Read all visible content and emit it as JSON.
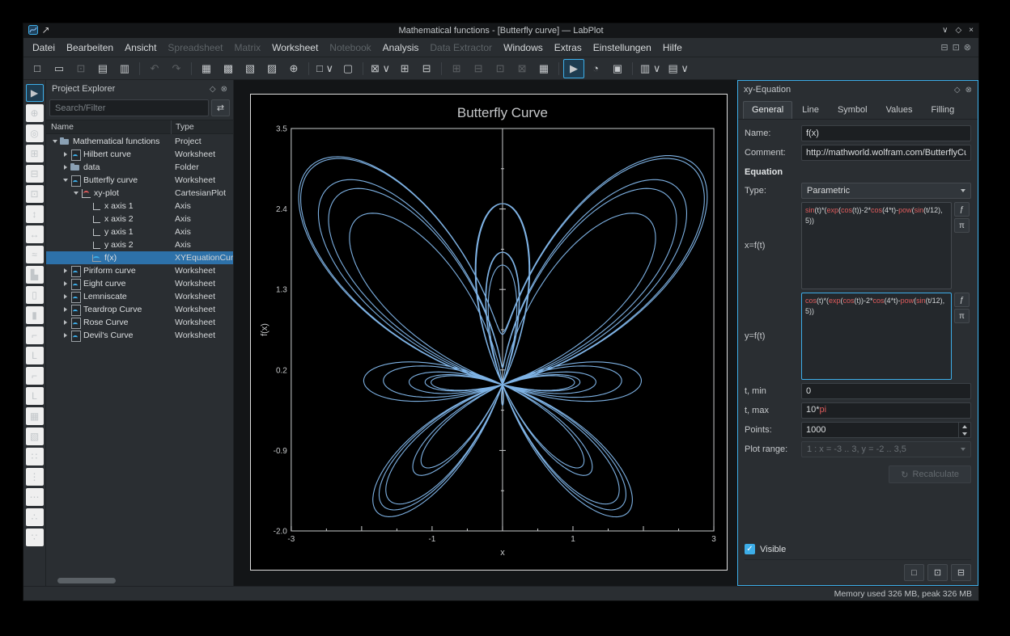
{
  "window": {
    "title": "Mathematical functions - [Butterfly curve] — LabPlot"
  },
  "icons": {
    "chevron_down": "∨",
    "diamond": "◇",
    "close": "×",
    "float_dock": "◇",
    "close_dock": "⊗",
    "mdi_minimize": "⊟",
    "mdi_restore": "⊡",
    "mdi_close": "⊗",
    "search_config": "⇄",
    "function_btn": "ƒ",
    "constant_btn": "π",
    "recalculate": "↻",
    "check": "✓",
    "template_new": "□",
    "template_save": "⊡",
    "template_export": "⊟"
  },
  "menu": {
    "items": [
      {
        "label": "Datei",
        "dataName": "menu-datei"
      },
      {
        "label": "Bearbeiten",
        "dataName": "menu-bearbeiten"
      },
      {
        "label": "Ansicht",
        "dataName": "menu-ansicht"
      },
      {
        "label": "Spreadsheet",
        "dataName": "menu-spreadsheet",
        "class": "disabled"
      },
      {
        "label": "Matrix",
        "dataName": "menu-matrix",
        "class": "disabled"
      },
      {
        "label": "Worksheet",
        "dataName": "menu-worksheet"
      },
      {
        "label": "Notebook",
        "dataName": "menu-notebook",
        "class": "disabled"
      },
      {
        "label": "Analysis",
        "dataName": "menu-analysis"
      },
      {
        "label": "Data Extractor",
        "dataName": "menu-data-extractor",
        "class": "disabled"
      },
      {
        "label": "Windows",
        "dataName": "menu-windows"
      },
      {
        "label": "Extras",
        "dataName": "menu-extras"
      },
      {
        "label": "Einstellungen",
        "dataName": "menu-einstellungen"
      },
      {
        "label": "Hilfe",
        "dataName": "menu-hilfe"
      }
    ]
  },
  "toolbar": {
    "items": [
      {
        "glyph": "□",
        "dataName": "toolbar-new-project-button"
      },
      {
        "glyph": "▭",
        "dataName": "toolbar-open-project-button"
      },
      {
        "glyph": "⊡",
        "dataName": "toolbar-save-project-button",
        "class": "disabled"
      },
      {
        "glyph": "▤",
        "dataName": "toolbar-print-button"
      },
      {
        "glyph": "▥",
        "dataName": "toolbar-print-preview-button"
      },
      {
        "glyph": "",
        "dataName": "toolbar-separator",
        "class": "sep",
        "inter": "false"
      },
      {
        "glyph": "↶",
        "dataName": "toolbar-undo-button",
        "class": "disabled"
      },
      {
        "glyph": "↷",
        "dataName": "toolbar-redo-button",
        "class": "disabled"
      },
      {
        "glyph": "",
        "dataName": "toolbar-separator",
        "class": "sep",
        "inter": "false"
      },
      {
        "glyph": "▦",
        "dataName": "toolbar-new-spreadsheet-button"
      },
      {
        "glyph": "▩",
        "dataName": "toolbar-new-matrix-button"
      },
      {
        "glyph": "▧",
        "dataName": "toolbar-new-worksheet-button"
      },
      {
        "glyph": "▨",
        "dataName": "toolbar-new-notebook-button"
      },
      {
        "glyph": "⊕",
        "dataName": "toolbar-new-datapicker-button"
      },
      {
        "glyph": "",
        "dataName": "toolbar-separator",
        "class": "sep",
        "inter": "false"
      },
      {
        "glyph": "□ ∨",
        "dataName": "toolbar-new-object-dropdown"
      },
      {
        "glyph": "▢",
        "dataName": "toolbar-new-folder-button"
      },
      {
        "glyph": "",
        "dataName": "toolbar-separator",
        "class": "sep",
        "inter": "false"
      },
      {
        "glyph": "⊠ ∨",
        "dataName": "toolbar-zoom-dropdown"
      },
      {
        "glyph": "⊞",
        "dataName": "toolbar-zoom-fit-button"
      },
      {
        "glyph": "⊟",
        "dataName": "toolbar-zoom-original-button"
      },
      {
        "glyph": "",
        "dataName": "toolbar-separator",
        "class": "sep",
        "inter": "false"
      },
      {
        "glyph": "⊞",
        "dataName": "toolbar-split-horizontal-button",
        "class": "disabled"
      },
      {
        "glyph": "⊟",
        "dataName": "toolbar-split-vertical-button",
        "class": "disabled"
      },
      {
        "glyph": "⊡",
        "dataName": "toolbar-close-split-button",
        "class": "disabled"
      },
      {
        "glyph": "⊠",
        "dataName": "toolbar-close-window-button",
        "class": "disabled"
      },
      {
        "glyph": "▦",
        "dataName": "toolbar-add-plot-button"
      },
      {
        "glyph": "",
        "dataName": "toolbar-separator",
        "class": "sep",
        "inter": "false"
      },
      {
        "glyph": "▶",
        "dataName": "toolbar-navigate-mode-button",
        "class": "active"
      },
      {
        "glyph": "◔",
        "dataName": "toolbar-presenter-mode-button"
      },
      {
        "glyph": "▣",
        "dataName": "toolbar-fullscreen-button"
      },
      {
        "glyph": "",
        "dataName": "toolbar-separator",
        "class": "sep",
        "inter": "false"
      },
      {
        "glyph": "▥ ∨",
        "dataName": "toolbar-layout-dropdown"
      },
      {
        "glyph": "▤ ∨",
        "dataName": "toolbar-arrange-dropdown"
      }
    ]
  },
  "left_toolbar": {
    "items": [
      {
        "glyph": "▶",
        "dataName": "tool-select-button",
        "class": "active"
      },
      {
        "glyph": "⊕",
        "dataName": "tool-crosshair-button"
      },
      {
        "glyph": "◎",
        "dataName": "tool-zoom-select-button"
      },
      {
        "glyph": "⊞",
        "dataName": "tool-zoom-box-button"
      },
      {
        "glyph": "⊟",
        "dataName": "tool-zoom-x-button"
      },
      {
        "glyph": "⊡",
        "dataName": "tool-zoom-y-button"
      },
      {
        "glyph": "↕",
        "dataName": "tool-shift-vertical-button"
      },
      {
        "glyph": "↔",
        "dataName": "tool-shift-horizontal-button"
      },
      {
        "glyph": "≈",
        "dataName": "tool-add-curve-button"
      },
      {
        "glyph": "▙",
        "dataName": "tool-add-histogram-button"
      },
      {
        "glyph": "▯",
        "dataName": "tool-add-boxplot-button"
      },
      {
        "glyph": "▮",
        "dataName": "tool-add-barplot-button"
      },
      {
        "glyph": "⌐",
        "dataName": "tool-add-axis-top-button"
      },
      {
        "glyph": "L",
        "dataName": "tool-add-axis-left-button"
      },
      {
        "glyph": "⌐",
        "dataName": "tool-add-axis-right-button"
      },
      {
        "glyph": "L",
        "dataName": "tool-add-axis-bottom-button"
      },
      {
        "glyph": "▦",
        "dataName": "tool-add-cartesian-plot-button"
      },
      {
        "glyph": "▧",
        "dataName": "tool-add-plot-template-button"
      },
      {
        "glyph": "∷",
        "dataName": "tool-align-grid-button"
      },
      {
        "glyph": "⋮",
        "dataName": "tool-align-vertical-button"
      },
      {
        "glyph": "⋯",
        "dataName": "tool-align-horizontal-button"
      },
      {
        "glyph": "∴",
        "dataName": "tool-distribute-button"
      },
      {
        "glyph": "∵",
        "dataName": "tool-snap-button"
      }
    ]
  },
  "project_explorer": {
    "title": "Project Explorer",
    "search_placeholder": "Search/Filter",
    "columns": {
      "name": "Name",
      "type": "Type"
    },
    "rows": [
      {
        "name": "Mathematical functions",
        "type": "Project",
        "level": 0,
        "expClass": "exp open",
        "iconClass": "row-icon icon-project",
        "dataName": "tree-row-mathematical-functions"
      },
      {
        "name": "Hilbert curve",
        "type": "Worksheet",
        "level": 1,
        "expClass": "exp closed",
        "iconClass": "row-icon icon-worksheet",
        "dataName": "tree-row-hilbert-curve"
      },
      {
        "name": "data",
        "type": "Folder",
        "level": 1,
        "expClass": "exp closed",
        "iconClass": "row-icon icon-folder",
        "dataName": "tree-row-data"
      },
      {
        "name": "Butterfly curve",
        "type": "Worksheet",
        "level": 1,
        "expClass": "exp open",
        "iconClass": "row-icon icon-worksheet",
        "dataName": "tree-row-butterfly-curve"
      },
      {
        "name": "xy-plot",
        "type": "CartesianPlot",
        "level": 2,
        "expClass": "exp open",
        "iconClass": "row-icon icon-plot",
        "dataName": "tree-row-xy-plot"
      },
      {
        "name": "x axis 1",
        "type": "Axis",
        "level": 3,
        "expClass": "exp none",
        "expInter": "false",
        "iconClass": "row-icon icon-axis",
        "dataName": "tree-row-x-axis-1"
      },
      {
        "name": "x axis 2",
        "type": "Axis",
        "level": 3,
        "expClass": "exp none",
        "expInter": "false",
        "iconClass": "row-icon icon-axis",
        "dataName": "tree-row-x-axis-2"
      },
      {
        "name": "y axis 1",
        "type": "Axis",
        "level": 3,
        "expClass": "exp none",
        "expInter": "false",
        "iconClass": "row-icon icon-axis",
        "dataName": "tree-row-y-axis-1"
      },
      {
        "name": "y axis 2",
        "type": "Axis",
        "level": 3,
        "expClass": "exp none",
        "expInter": "false",
        "iconClass": "row-icon icon-axis",
        "dataName": "tree-row-y-axis-2"
      },
      {
        "name": "f(x)",
        "type": "XYEquationCurve",
        "level": 3,
        "class": "selected",
        "expClass": "exp none",
        "expInter": "false",
        "iconClass": "row-icon icon-curve",
        "dataName": "tree-row-fx"
      },
      {
        "name": "Piriform curve",
        "type": "Worksheet",
        "level": 1,
        "expClass": "exp closed",
        "iconClass": "row-icon icon-worksheet",
        "dataName": "tree-row-piriform-curve"
      },
      {
        "name": "Eight curve",
        "type": "Worksheet",
        "level": 1,
        "expClass": "exp closed",
        "iconClass": "row-icon icon-worksheet",
        "dataName": "tree-row-eight-curve"
      },
      {
        "name": "Lemniscate",
        "type": "Worksheet",
        "level": 1,
        "expClass": "exp closed",
        "iconClass": "row-icon icon-worksheet",
        "dataName": "tree-row-lemniscate"
      },
      {
        "name": "Teardrop Curve",
        "type": "Worksheet",
        "level": 1,
        "expClass": "exp closed",
        "iconClass": "row-icon icon-worksheet",
        "dataName": "tree-row-teardrop-curve"
      },
      {
        "name": "Rose Curve",
        "type": "Worksheet",
        "level": 1,
        "expClass": "exp closed",
        "iconClass": "row-icon icon-worksheet",
        "dataName": "tree-row-rose-curve"
      },
      {
        "name": "Devil's Curve",
        "type": "Worksheet",
        "level": 1,
        "expClass": "exp closed",
        "iconClass": "row-icon icon-worksheet",
        "dataName": "tree-row-devils-curve"
      }
    ]
  },
  "chart_data": {
    "type": "line",
    "title": "Butterfly Curve",
    "xlabel": "x",
    "ylabel": "f(x)",
    "parametric": {
      "x_t": "sin(t)*(exp(cos(t))-2*cos(4*t)-pow(sin(t/12), 5))",
      "y_t": "cos(t)*(exp(cos(t))-2*cos(4*t)-pow(sin(t/12),5))",
      "t_min": "0",
      "t_max": "10*pi",
      "points": 1000
    },
    "xlim": [
      -3,
      3
    ],
    "ylim": [
      -2,
      3.5
    ],
    "xticks": [
      -3,
      -2,
      -1,
      0,
      1,
      2,
      3
    ],
    "xtick_labeled": [
      -3,
      -1,
      1,
      3
    ],
    "xtick_labels": [
      "-3",
      "-1",
      "1",
      "3"
    ],
    "yticks": [
      3.5,
      2.4,
      1.3,
      0.2,
      -0.9,
      -2.0
    ],
    "ytick_labels": [
      "3.5",
      "2.4",
      "1.3",
      "0.2",
      "-0.9",
      "-2.0"
    ],
    "grid": false,
    "legend": false,
    "colors": {
      "curve": "#7eb2e4",
      "frame": "#c9cbcd",
      "text": "#c6c8ca",
      "background": "#000000"
    }
  },
  "equation_panel": {
    "title": "xy-Equation",
    "tabs": [
      {
        "label": "General",
        "class": "active",
        "dataName": "tab-general"
      },
      {
        "label": "Line",
        "dataName": "tab-line"
      },
      {
        "label": "Symbol",
        "dataName": "tab-symbol"
      },
      {
        "label": "Values",
        "dataName": "tab-values"
      },
      {
        "label": "Filling",
        "dataName": "tab-filling"
      }
    ],
    "fields": {
      "name_label": "Name:",
      "name_value": "f(x)",
      "comment_label": "Comment:",
      "comment_value": "http://mathworld.wolfram.com/ButterflyCurve.html",
      "section_equation": "Equation",
      "type_label": "Type:",
      "type_value": "Parametric",
      "x_label": "x=f(t)",
      "x_value": "sin(t)*(exp(cos(t))-2*cos(4*t)-pow(sin(t/12), 5))",
      "y_label": "y=f(t)",
      "y_value": "cos(t)*(exp(cos(t))-2*cos(4*t)-pow(sin(t/12),5))",
      "tmin_label": "t, min",
      "tmin_value": "0",
      "tmax_label": "t, max",
      "tmax_value": "10*pi",
      "points_label": "Points:",
      "points_value": "1000",
      "plot_range_label": "Plot range:",
      "plot_range_value": "1 : x = -3 .. 3, y = -2 .. 3,5",
      "recalculate_label": "Recalculate",
      "visible_label": "Visible",
      "visible_checked": true
    }
  },
  "status_bar": {
    "memory": "Memory used 326 MB, peak 326 MB"
  }
}
